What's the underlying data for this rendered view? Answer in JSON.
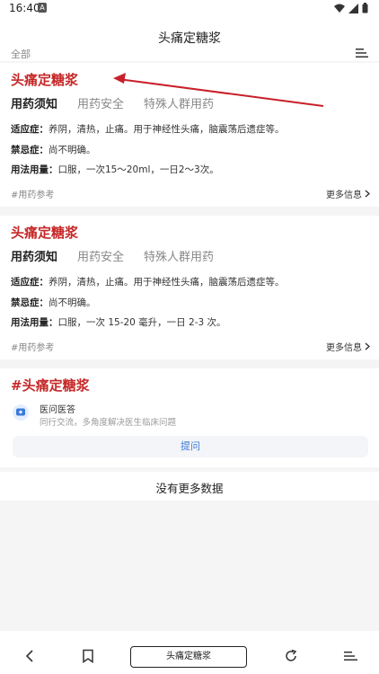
{
  "status_bar": {
    "time": "16:40",
    "sim_label": "A"
  },
  "header": {
    "title": "头痛定糖浆",
    "filter_label": "全部"
  },
  "cards": [
    {
      "drug_name": "头痛定糖浆",
      "tabs": [
        "用药须知",
        "用药安全",
        "特殊人群用药"
      ],
      "indication_label": "适应症：",
      "indication": "养阴，清热，止痛。用于神经性头痛，脑震荡后遗症等。",
      "contra_label": "禁忌症：",
      "contra": "尚不明确。",
      "dosage_label": "用法用量：",
      "dosage": "口服，一次15～20ml，一日2～3次。",
      "ref": "#用药参考",
      "more": "更多信息"
    },
    {
      "drug_name": "头痛定糖浆",
      "tabs": [
        "用药须知",
        "用药安全",
        "特殊人群用药"
      ],
      "indication_label": "适应症：",
      "indication": "养阴，清热，止痛。用于神经性头痛，脑震荡后遗症等。",
      "contra_label": "禁忌症：",
      "contra": "尚不明确。",
      "dosage_label": "用法用量：",
      "dosage": "口服，一次 15-20 毫升，一日 2-3 次。",
      "ref": "#用药参考",
      "more": "更多信息"
    }
  ],
  "qa": {
    "hashtag_title": "#头痛定糖浆",
    "title": "医问医答",
    "subtitle": "同行交流，多角度解决医生临床问题",
    "ask_button": "提问"
  },
  "footer_text": "没有更多数据",
  "bottom_bar": {
    "title": "头痛定糖浆"
  },
  "colors": {
    "accent_red": "#c62828",
    "link_blue": "#3b7ad8",
    "annotation_arrow": "#c8202a"
  }
}
